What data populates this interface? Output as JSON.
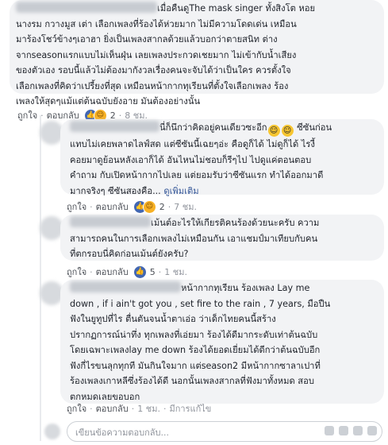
{
  "comments": [
    {
      "id": "c1",
      "lead": "เมื่อคืนดูThe mask singer ทั้งสิงโต หอย",
      "lines": [
        "นางรม กวางมูส เต่า เลือกเพลงที่ร้องได้ห่วยมาก ไม่มีความโดดเด่น เหมือน",
        "มาร้องโชว์ข้างๆเอาฮา ยิ่งเป็นเพลงสากลด้วยแล้วบอกว่าตายสนิท ต่าง",
        "จากseasonแรกแบบไม่เห็นฝุ่น เลยเพลงประกวดเชยมาก ไม่เข้ากับน้ำเสียง",
        "ของตัวเอง รอบนี้แล้วไม่ต้องมากังวลเรื่องคนจะจับได้ว่าเป็นใคร ควรตั้งใจ",
        "เลือกเพลงที่คิดว่าเปรี้ยงที่สุด เหมือนหน้ากากทุเรียนที่ตั้งใจเลือกเพลง ร้อง",
        "เพลงให้สุดๆแม้แต่ต้นฉบับยังอาย มันต้องอย่างนั้น"
      ],
      "like": "ถูกใจ",
      "reply": "ตอบกลับ",
      "reaction_count": "2",
      "time": "8 ชม."
    },
    {
      "id": "c2",
      "lead": "นี่ก็นึกว่าคิดอยู่คนเดียวซะอีก",
      "lead_tail": " ซีซันก่อน",
      "lines": [
        "แทบไม่เคยพลาดไลฟ์สด แต่ซีซันนี้เฉยๆอ่ะ คือดูก็ได้ ไม่ดูก็ได้ ไรงี้",
        "คอยมาดูย้อนหลังเอาก็ได้ อันไหนไม่ชอบก็รีๆไป ไปดูแค่ตอนตอบ",
        "คำถาม กับเปิดหน้ากากไปเลย แต่ยอมรับว่าซีซันแรก ทำได้ออกมาดี",
        "มากจริงๆ ซีซันสองคือ..."
      ],
      "see_more": "ดูเพิ่มเติม",
      "like": "ถูกใจ",
      "reply": "ตอบกลับ",
      "reaction_count": "2",
      "time": "7 ชม."
    },
    {
      "id": "c3",
      "lead": "เม้นต์อะไรให้เกียรติคนร้องด้วยนะครับ ความ",
      "lines": [
        "สามารถคนในการเลือกเพลงไม่เหมือนกัน เอาแชมป์มาเทียบกับคน",
        "ที่ตกรอบนี่คิดก่อนเม้นต์ยังครับ?"
      ],
      "like": "ถูกใจ",
      "reply": "ตอบกลับ",
      "reaction_count": "5",
      "time": "1 ชม."
    },
    {
      "id": "c4",
      "lead": "หน้ากากทุเรียน ร้องเพลง Lay me",
      "lines": [
        "down , if i ain't got you , set fire to the rain , 7 years, มือปืน",
        "ฟังในยูทูปที่ไร ตื่นตันจนน้ำตาเอ่อ ว่าเด็กไทยคนนี้สร้าง",
        "ปรากฏการณ์น่าทึ่ง ทุกเพลงที่เอ่ยมา ร้องได้ดีมากระดับเท่าต้นฉบับ",
        "โดยเฉพาะเพลงlay me down ร้องได้ยอดเยี่ยมได้ดีกว่าต้นฉบับอีก",
        "ฟังกี่ไรขนลุกทุกที มันกินใจมาก แต่season2 มีหน้ากากซาลาเปาที่",
        "ร้องเพลงเกาหลีซึ่งร้องได้ดี นอกนั้นเพลงสากลที่ฟังมาทั้งหมด สอบ",
        "ตกหมดเลยขอบอก"
      ],
      "like": "ถูกใจ",
      "reply": "ตอบกลับ",
      "time": "1 ชม.",
      "edited": "มีการแก้ไข"
    }
  ],
  "reply_input": {
    "placeholder": "เขียนข้อความตอบกลับ..."
  }
}
